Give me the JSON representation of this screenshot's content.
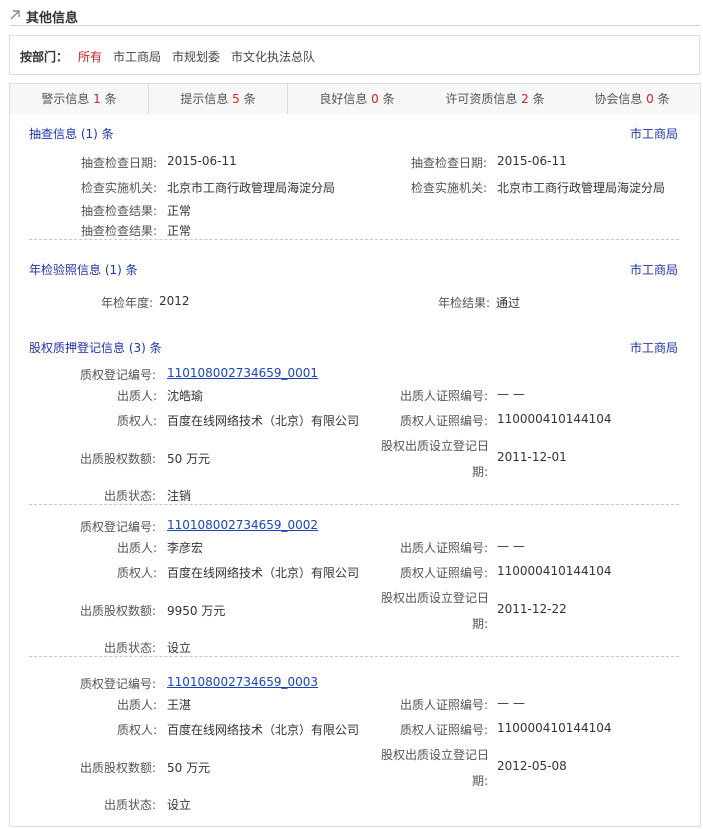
{
  "header": {
    "title": "其他信息",
    "icon": "arrow-icon"
  },
  "departments": {
    "label": "按部门：",
    "items": [
      "所有",
      "市工商局",
      "市规划委",
      "市文化执法总队"
    ],
    "active_color": "#cc2222"
  },
  "tabs": [
    {
      "label": "警示信息",
      "count": "1",
      "unit": "条"
    },
    {
      "label": "提示信息",
      "count": "5",
      "unit": "条"
    },
    {
      "label": "良好信息",
      "count": "0",
      "unit": "条"
    },
    {
      "label": "许可资质信息",
      "count": "2",
      "unit": "条"
    },
    {
      "label": "协会信息",
      "count": "0",
      "unit": "条"
    }
  ],
  "inspection": {
    "title": "抽查信息 (1) 条",
    "source": "市工商局",
    "date_label": "抽查检查日期:",
    "date": "2015-06-11",
    "agency_label": "检查实施机关:",
    "agency": "北京市工商行政管理局海淀分局",
    "result_label": "抽查检查结果:",
    "result": "正常"
  },
  "annual": {
    "title": "年检验照信息 (1) 条",
    "source": "市工商局",
    "year_label": "年检年度:",
    "year": "2012",
    "result_label": "年检结果:",
    "result": "通过"
  },
  "pledge": {
    "title": "股权质押登记信息 (3) 条",
    "source": "市工商局",
    "labels": {
      "reg_no": "质权登记编号:",
      "pledgor": "出质人:",
      "pledgor_id": "出质人证照编号:",
      "pledgee": "质权人:",
      "pledgee_id": "质权人证照编号:",
      "amount": "出质股权数额:",
      "date_line1": "股权出质设立登记日",
      "date_line2": "期:",
      "status": "出质状态:"
    },
    "records": [
      {
        "reg_no": "110108002734659_0001",
        "pledgor": "沈皓瑜",
        "pledgor_id": "— —",
        "pledgee": "百度在线网络技术（北京）有限公司",
        "pledgee_id": "110000410144104",
        "amount": "50 万元",
        "date": "2011-12-01",
        "status": "注销"
      },
      {
        "reg_no": "110108002734659_0002",
        "pledgor": "李彦宏",
        "pledgor_id": "— —",
        "pledgee": "百度在线网络技术（北京）有限公司",
        "pledgee_id": "110000410144104",
        "amount": "9950 万元",
        "date": "2011-12-22",
        "status": "设立"
      },
      {
        "reg_no": "110108002734659_0003",
        "pledgor": "王湛",
        "pledgor_id": "— —",
        "pledgee": "百度在线网络技术（北京）有限公司",
        "pledgee_id": "110000410144104",
        "amount": "50 万元",
        "date": "2012-05-08",
        "status": "设立"
      }
    ]
  }
}
